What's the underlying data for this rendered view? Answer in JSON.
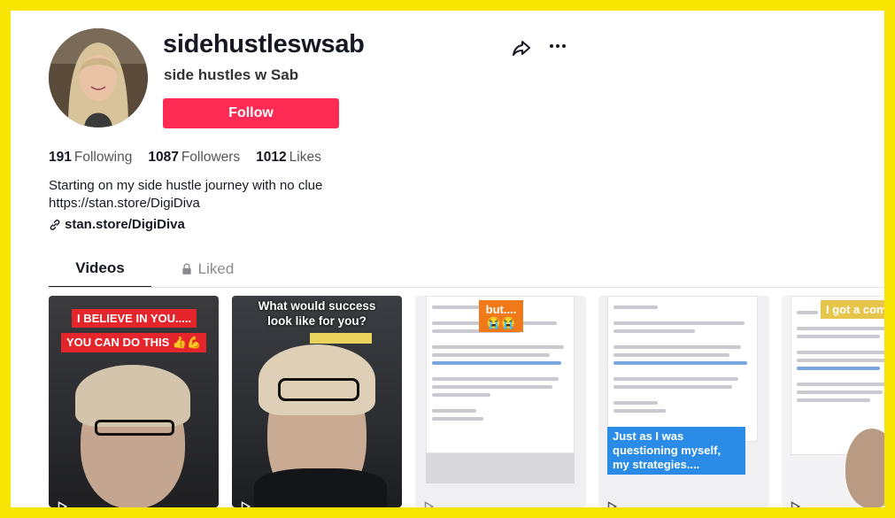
{
  "profile": {
    "username": "sidehustleswsab",
    "nickname": "side hustles w Sab",
    "follow_label": "Follow",
    "bio_line1": "Starting on my side hustle journey with no clue",
    "bio_line2": "https://stan.store/DigiDiva",
    "link": "stan.store/DigiDiva"
  },
  "stats": {
    "following_count": "191",
    "following_label": "Following",
    "followers_count": "1087",
    "followers_label": "Followers",
    "likes_count": "1012",
    "likes_label": "Likes"
  },
  "tabs": {
    "videos": "Videos",
    "liked": "Liked"
  },
  "videos": [
    {
      "caption1": "I BELIEVE IN YOU.....",
      "caption2": "YOU CAN DO THIS 👍💪"
    },
    {
      "caption1": "What would success look like for you?"
    },
    {
      "caption1": "but.... 😭😭"
    },
    {
      "caption1": "Just as I was questioning myself, my strategies...."
    },
    {
      "caption1": "I got a com"
    }
  ],
  "icons": {
    "share": "share-icon",
    "more": "more-icon",
    "link": "link-icon",
    "lock": "lock-icon",
    "play": "play-icon"
  },
  "colors": {
    "follow": "#fe2c55",
    "frame": "#f7e400"
  }
}
